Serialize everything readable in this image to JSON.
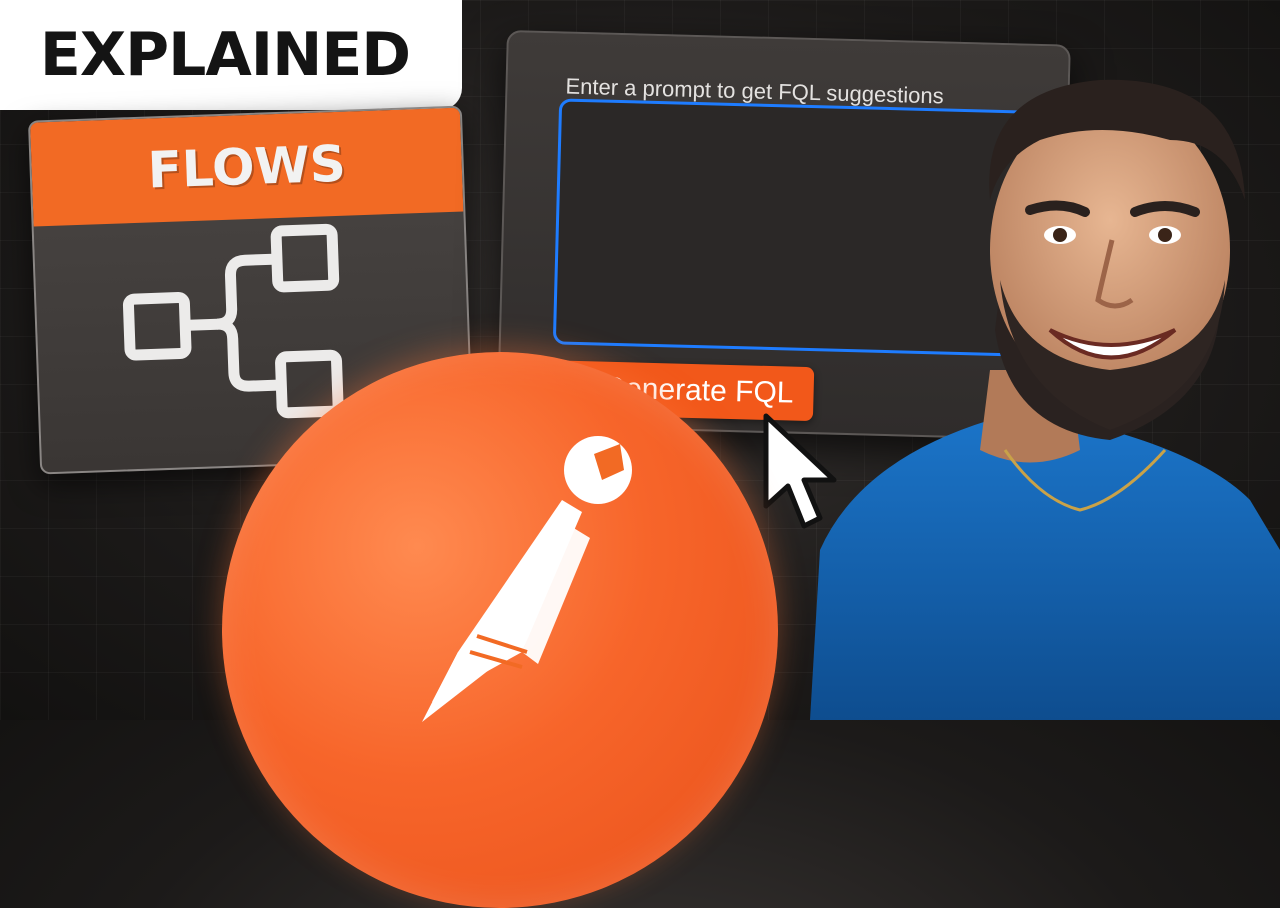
{
  "badge": {
    "text": "EXPLAINED"
  },
  "flows_card": {
    "title": "FLOWS",
    "icon": "flow-diagram-icon"
  },
  "prompt_panel": {
    "label": "Enter a prompt to get FQL suggestions",
    "input_value": "",
    "button_label": "Generate FQL",
    "button_icon": "search-icon"
  },
  "logo": {
    "icon": "postman-logo-icon"
  },
  "cursor": {
    "icon": "mouse-pointer-icon"
  },
  "colors": {
    "accent_orange": "#f26a24",
    "focus_blue": "#1e7cff",
    "shirt_blue": "#1565b0",
    "background": "#1c1a19"
  }
}
